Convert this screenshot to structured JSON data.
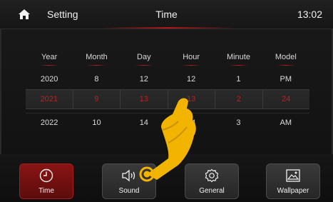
{
  "header": {
    "setting_label": "Setting",
    "title": "Time",
    "clock": "13:02"
  },
  "picker": {
    "columns": [
      "Year",
      "Month",
      "Day",
      "Hour",
      "Minute",
      "Model"
    ],
    "rows": [
      [
        "2020",
        "8",
        "12",
        "12",
        "1",
        "PM"
      ],
      [
        "2021",
        "9",
        "13",
        "13",
        "2",
        "24"
      ],
      [
        "2022",
        "10",
        "14",
        "14",
        "3",
        "AM"
      ]
    ],
    "selected_row_index": 1
  },
  "tabs": [
    {
      "label": "Time",
      "icon": "clock-icon",
      "active": true
    },
    {
      "label": "Sound",
      "icon": "speaker-icon",
      "active": false
    },
    {
      "label": "General",
      "icon": "gear-icon",
      "active": false
    },
    {
      "label": "Wallpaper",
      "icon": "image-icon",
      "active": false
    }
  ],
  "colors": {
    "accent_red": "#c11f1f",
    "tile_active": "#8a1414",
    "hand": "#f3b400"
  }
}
